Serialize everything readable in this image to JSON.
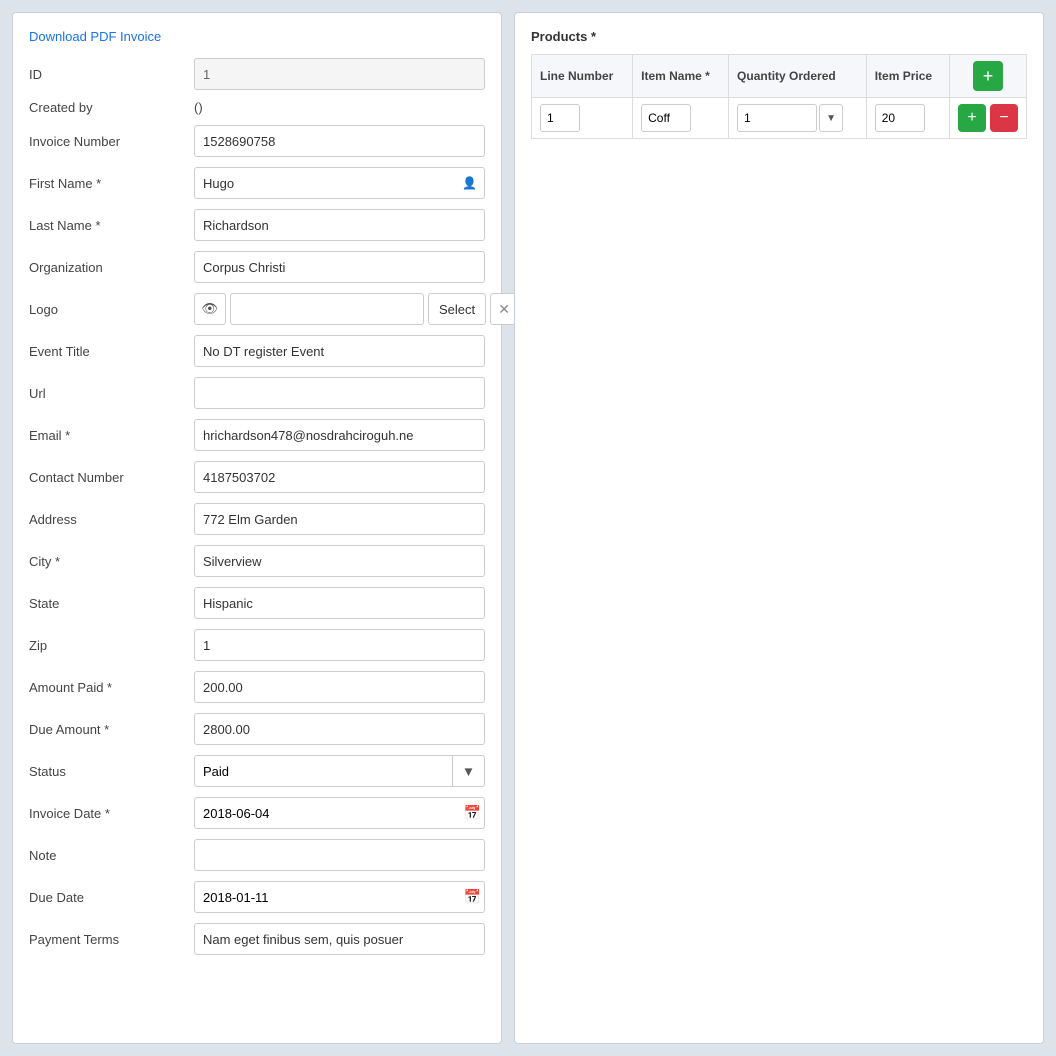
{
  "left": {
    "download_label": "Download PDF Invoice",
    "fields": {
      "id_label": "ID",
      "id_value": "1",
      "created_by_label": "Created by",
      "created_by_value": "()",
      "invoice_number_label": "Invoice Number",
      "invoice_number_value": "1528690758",
      "first_name_label": "First Name *",
      "first_name_value": "Hugo",
      "last_name_label": "Last Name *",
      "last_name_value": "Richardson",
      "organization_label": "Organization",
      "organization_value": "Corpus Christi",
      "logo_label": "Logo",
      "logo_select_label": "Select",
      "event_title_label": "Event Title",
      "event_title_value": "No DT register Event",
      "url_label": "Url",
      "url_value": "",
      "email_label": "Email *",
      "email_value": "hrichardson478@nosdrahciroguh.ne",
      "contact_label": "Contact Number",
      "contact_value": "4187503702",
      "address_label": "Address",
      "address_value": "772 Elm Garden",
      "city_label": "City *",
      "city_value": "Silverview",
      "state_label": "State",
      "state_value": "Hispanic",
      "zip_label": "Zip",
      "zip_value": "1",
      "amount_paid_label": "Amount Paid *",
      "amount_paid_value": "200.00",
      "due_amount_label": "Due Amount *",
      "due_amount_value": "2800.00",
      "status_label": "Status",
      "status_value": "Paid",
      "invoice_date_label": "Invoice Date *",
      "invoice_date_value": "2018-06-04",
      "note_label": "Note",
      "note_value": "",
      "due_date_label": "Due Date",
      "due_date_value": "2018-01-11",
      "payment_terms_label": "Payment Terms",
      "payment_terms_value": "Nam eget finibus sem, quis posuer"
    }
  },
  "right": {
    "products_label": "Products *",
    "table": {
      "col_line_number": "Line Number",
      "col_item_name": "Item Name *",
      "col_quantity": "Quantity Ordered",
      "col_item_price": "Item Price",
      "row": {
        "line_number": "1",
        "item_name": "Coff",
        "quantity": "1",
        "item_price": "20"
      }
    }
  },
  "icons": {
    "eye": "👁",
    "calendar": "📅",
    "clear": "✕",
    "dropdown": "▼",
    "plus": "+",
    "minus": "−"
  }
}
